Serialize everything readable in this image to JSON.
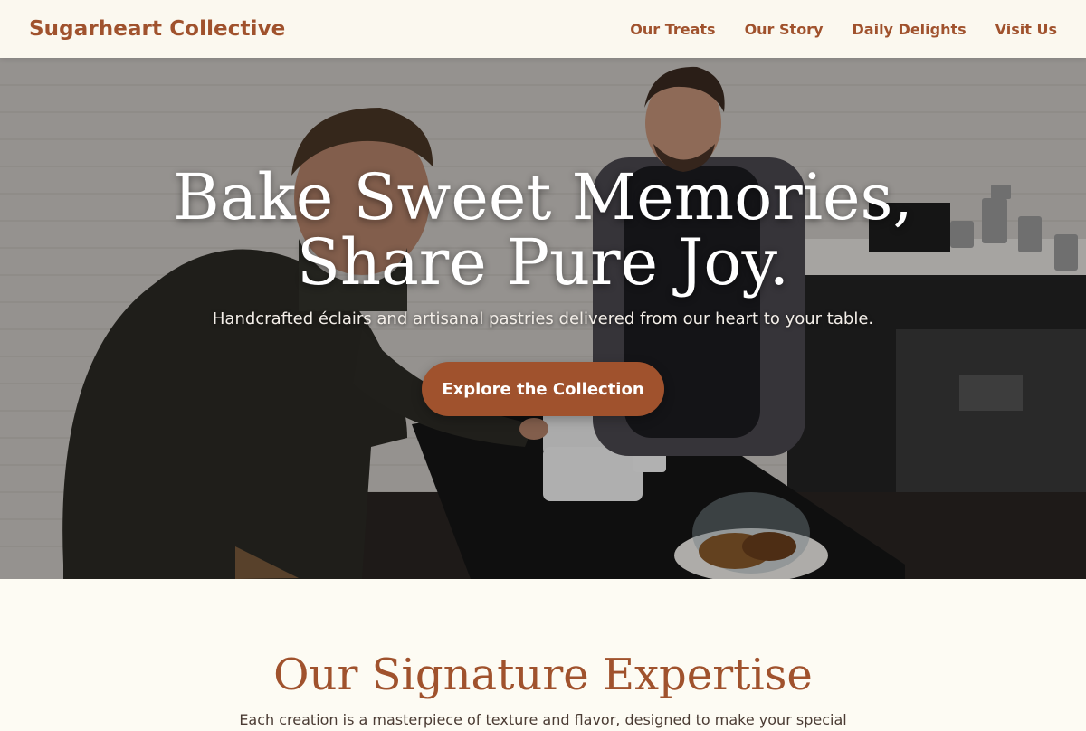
{
  "nav": {
    "brand": "Sugarheart Collective",
    "links": [
      "Our Treats",
      "Our Story",
      "Daily Delights",
      "Visit Us"
    ]
  },
  "hero": {
    "title_line1": "Bake Sweet Memories,",
    "title_line2": "Share Pure Joy.",
    "subtitle": "Handcrafted éclairs and artisanal pastries delivered from our heart to your table.",
    "cta_label": "Explore the Collection"
  },
  "expertise": {
    "title": "Our Signature Expertise",
    "text": "Each creation is a masterpiece of texture and flavor, designed to make your special"
  },
  "colors": {
    "accent": "#a0522d",
    "background": "#fdfbf3",
    "nav_background": "#fbf8ef"
  }
}
